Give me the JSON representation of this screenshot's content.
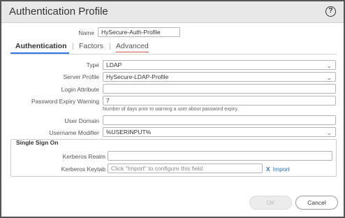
{
  "dialog": {
    "title": "Authentication Profile",
    "help_icon": "help-icon"
  },
  "name": {
    "label": "Name",
    "value": "HySecure-Auth-Profile"
  },
  "tabs": [
    {
      "label": "Authentication",
      "active": true
    },
    {
      "label": "Factors",
      "active": false
    },
    {
      "label": "Advanced",
      "active": false
    }
  ],
  "tab_separator": "|",
  "form": {
    "type": {
      "label": "Type",
      "value": "LDAP"
    },
    "server_profile": {
      "label": "Server Profile",
      "value": "HySecure-LDAP-Profile"
    },
    "login_attribute": {
      "label": "Login Attribute",
      "value": ""
    },
    "password_expiry": {
      "label": "Password Expiry Warning",
      "value": "7",
      "hint": "Number of days prior to warning a user about password expiry."
    },
    "user_domain": {
      "label": "User Domain",
      "value": ""
    },
    "username_modifier": {
      "label": "Username Modifier",
      "value": "%USERINPUT%"
    }
  },
  "sso": {
    "title": "Single Sign On",
    "kerberos_realm": {
      "label": "Kerberos Realm",
      "value": ""
    },
    "kerberos_keytab": {
      "label": "Kerberos Keytab",
      "placeholder": "Click \"Import\" to configure this field"
    },
    "import_label": "Import",
    "import_icon": "x-icon"
  },
  "buttons": {
    "ok": "OK",
    "cancel": "Cancel"
  },
  "colors": {
    "accent": "#2c7be5",
    "advanced_underline": "#d65b4a",
    "link": "#2a6fb9",
    "header_bg": "#e8e8e8"
  }
}
